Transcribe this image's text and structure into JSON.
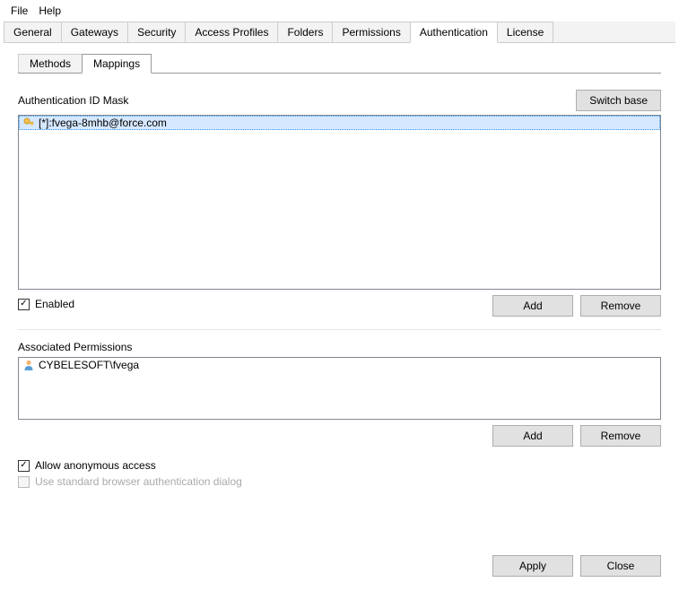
{
  "menubar": {
    "file": "File",
    "help": "Help"
  },
  "main_tabs": {
    "general": "General",
    "gateways": "Gateways",
    "security": "Security",
    "access_profiles": "Access Profiles",
    "folders": "Folders",
    "permissions": "Permissions",
    "authentication": "Authentication",
    "license": "License",
    "active": "authentication"
  },
  "sub_tabs": {
    "methods": "Methods",
    "mappings": "Mappings",
    "active": "mappings"
  },
  "auth_mask": {
    "label": "Authentication ID Mask",
    "switch_base": "Switch base",
    "items": [
      {
        "text": "[*]:fvega-8mhb@force.com",
        "selected": true
      }
    ]
  },
  "enabled": {
    "label": "Enabled",
    "checked": true
  },
  "buttons": {
    "add": "Add",
    "remove": "Remove",
    "apply": "Apply",
    "close": "Close"
  },
  "permissions": {
    "label": "Associated Permissions",
    "items": [
      {
        "text": "CYBELESOFT\\fvega"
      }
    ]
  },
  "anon": {
    "label": "Allow anonymous access",
    "checked": true
  },
  "std_browser": {
    "label": "Use standard browser authentication dialog",
    "checked": false,
    "disabled": true
  }
}
